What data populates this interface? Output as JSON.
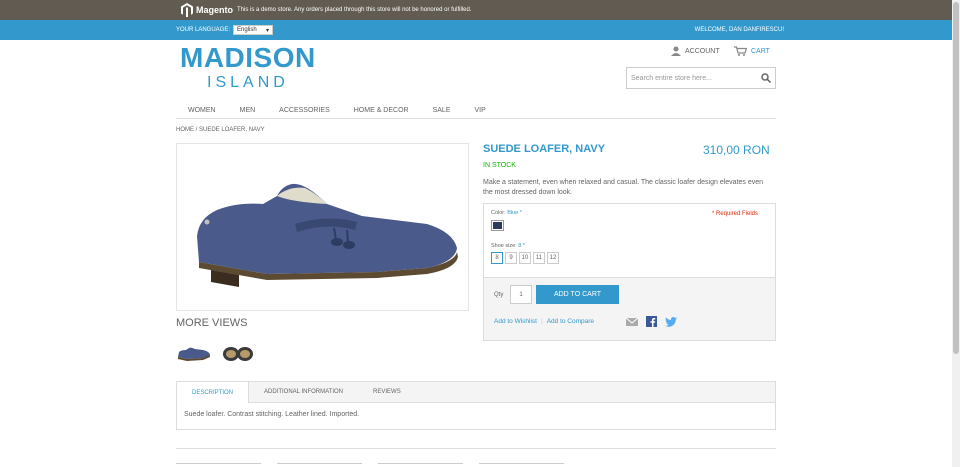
{
  "demo_bar": {
    "logo_text": "Magento",
    "notice": "This is a demo store. Any orders placed through this store will not be honored or fulfilled."
  },
  "lang_bar": {
    "label": "YOUR LANGUAGE:",
    "language": "English",
    "welcome": "WELCOME, DAN DANFIRESCU!"
  },
  "header": {
    "logo_line1": "MADISON",
    "logo_line2": "ISLAND",
    "account": "ACCOUNT",
    "cart": "CART",
    "search_placeholder": "Search entire store here..."
  },
  "nav": [
    "WOMEN",
    "MEN",
    "ACCESSORIES",
    "HOME & DECOR",
    "SALE",
    "VIP"
  ],
  "breadcrumb": {
    "home": "HOME",
    "sep": "/",
    "current": "SUEDE LOAFER, NAVY"
  },
  "product": {
    "name": "SUEDE LOAFER, NAVY",
    "price": "310,00 RON",
    "availability": "IN STOCK",
    "short_description": "Make a statement, even when relaxed and casual. The classic loafer design elevates even the most dressed down look.",
    "color_label": "Color:",
    "color_value": "Blue *",
    "required": "* Required Fields",
    "size_label": "Shoe size:",
    "size_value": "8 *",
    "sizes": [
      "8",
      "9",
      "10",
      "11",
      "12"
    ],
    "qty_label": "Qty",
    "qty": "1",
    "add_to_cart": "ADD TO CART",
    "wishlist": "Add to Wishlist",
    "link_sep": "|",
    "compare": "Add to Compare"
  },
  "more_views": "MORE VIEWS",
  "tabs": [
    "DESCRIPTION",
    "ADDITIONAL INFORMATION",
    "REVIEWS"
  ],
  "tab_content": "Suede loafer. Contrast stitching. Leather lined. Imported.",
  "colors": {
    "accent": "#3399cc",
    "demo_bar": "#625b51",
    "in_stock": "#11b400",
    "required": "#df280a"
  }
}
